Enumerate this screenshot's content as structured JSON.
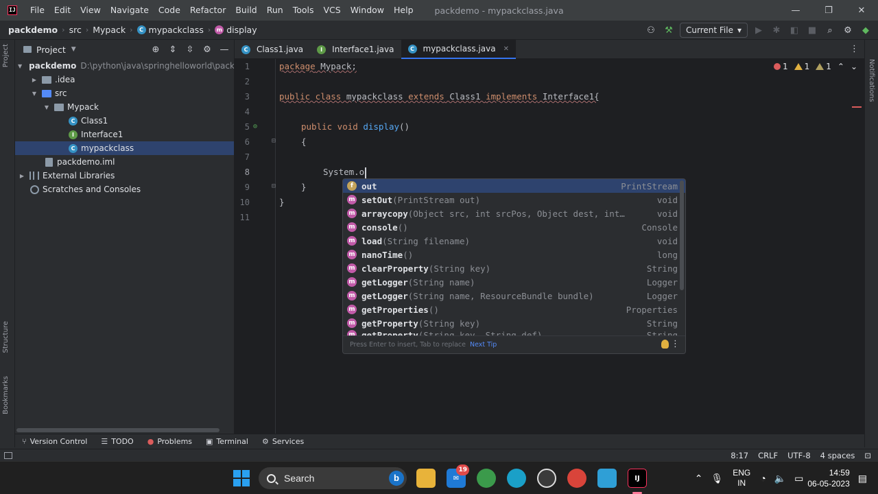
{
  "titlebar": {
    "logo_text": "IJ",
    "menu": [
      "File",
      "Edit",
      "View",
      "Navigate",
      "Code",
      "Refactor",
      "Build",
      "Run",
      "Tools",
      "VCS",
      "Window",
      "Help"
    ],
    "window_title": "packdemo - mypackclass.java",
    "minimize": "—",
    "restore": "❐",
    "close": "✕"
  },
  "navbar": {
    "crumbs": [
      "packdemo",
      "src",
      "Mypack",
      "mypackclass",
      "display"
    ],
    "run_config": "Current File"
  },
  "project_panel": {
    "title": "Project",
    "tree": [
      {
        "label": "packdemo",
        "sub": "D:\\python\\java\\springhelloworld\\packde"
      },
      {
        "label": ".idea"
      },
      {
        "label": "src"
      },
      {
        "label": "Mypack"
      },
      {
        "label": "Class1"
      },
      {
        "label": "Interface1"
      },
      {
        "label": "mypackclass"
      },
      {
        "label": "packdemo.iml"
      },
      {
        "label": "External Libraries"
      },
      {
        "label": "Scratches and Consoles"
      }
    ]
  },
  "left_stripe": {
    "project": "Project",
    "structure": "Structure",
    "bookmarks": "Bookmarks"
  },
  "right_stripe": {
    "notifications": "Notifications"
  },
  "tabs": [
    {
      "label": "Class1.java"
    },
    {
      "label": "Interface1.java"
    },
    {
      "label": "mypackclass.java"
    }
  ],
  "editor": {
    "line_numbers": [
      "1",
      "2",
      "3",
      "4",
      "5",
      "6",
      "7",
      "8",
      "9",
      "10",
      "11"
    ],
    "line1_kw": "package",
    "line1_rest": " Mypack;",
    "line3_kw1": "public class",
    "line3_name": " mypackclass ",
    "line3_kw2": "extends",
    "line3_cls": " Class1 ",
    "line3_kw3": "implements",
    "line3_iface": " Interface1{",
    "line5_kw": "public void",
    "line5_fn": " display",
    "line5_rest": "()",
    "line6": "{",
    "line8": "System.o",
    "line9": "}",
    "line10": "}",
    "inspections": {
      "errors": "1",
      "warnings": "1",
      "weak": "1"
    }
  },
  "completion": {
    "items": [
      {
        "icon": "f",
        "name": "out",
        "sig": "",
        "type": "PrintStream"
      },
      {
        "icon": "m",
        "name": "setOut",
        "sig": "(PrintStream out)",
        "type": "void"
      },
      {
        "icon": "m",
        "name": "arraycopy",
        "sig": "(Object src, int srcPos, Object dest, int…",
        "type": "void"
      },
      {
        "icon": "m",
        "name": "console",
        "sig": "()",
        "type": "Console"
      },
      {
        "icon": "m",
        "name": "load",
        "sig": "(String filename)",
        "type": "void"
      },
      {
        "icon": "m",
        "name": "nanoTime",
        "sig": "()",
        "type": "long"
      },
      {
        "icon": "m",
        "name": "clearProperty",
        "sig": "(String key)",
        "type": "String"
      },
      {
        "icon": "m",
        "name": "getLogger",
        "sig": "(String name)",
        "type": "Logger"
      },
      {
        "icon": "m",
        "name": "getLogger",
        "sig": "(String name, ResourceBundle bundle)",
        "type": "Logger"
      },
      {
        "icon": "m",
        "name": "getProperties",
        "sig": "()",
        "type": "Properties"
      },
      {
        "icon": "m",
        "name": "getProperty",
        "sig": "(String key)",
        "type": "String"
      },
      {
        "icon": "m",
        "name": "getProperty",
        "sig": "(String key, String def)",
        "type": "String"
      }
    ],
    "footer_hint": "Press Enter to insert, Tab to replace",
    "footer_tip": "Next Tip"
  },
  "tool_windows": [
    {
      "label": "Version Control"
    },
    {
      "label": "TODO"
    },
    {
      "label": "Problems"
    },
    {
      "label": "Terminal"
    },
    {
      "label": "Services"
    }
  ],
  "statusbar": {
    "position": "8:17",
    "line_sep": "CRLF",
    "encoding": "UTF-8",
    "indent": "4 spaces"
  },
  "taskbar": {
    "search_placeholder": "Search",
    "mail_badge": "19",
    "lang1": "ENG",
    "lang2": "IN",
    "time": "14:59",
    "date": "06-05-2023"
  },
  "colors": {
    "accent": "#3574f0",
    "selection": "#2e436e",
    "keyword": "#cf8e6d",
    "function": "#56a8f5"
  }
}
